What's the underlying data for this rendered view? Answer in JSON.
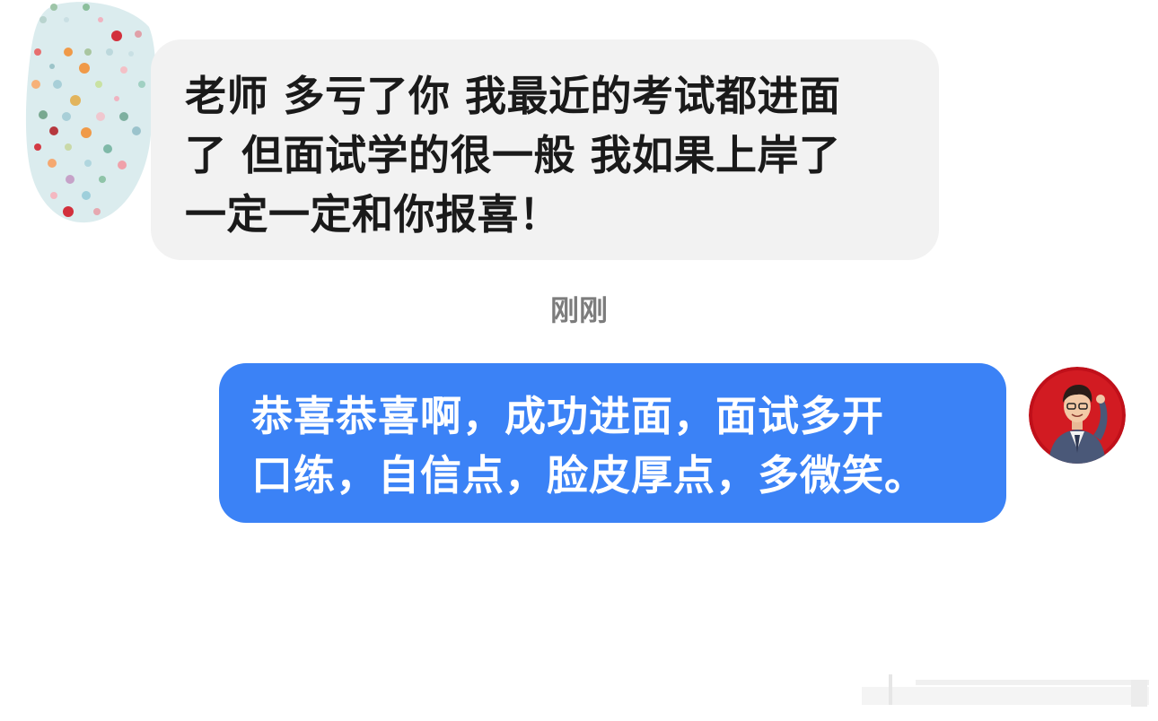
{
  "messages": {
    "incoming": {
      "text": "老师 多亏了你 我最近的考试都进面\n了 但面试学的很一般 我如果上岸了\n一定一定和你报喜！"
    },
    "timestamp": "刚刚",
    "outgoing": {
      "text": "恭喜恭喜啊，成功进面，面试多开\n口练，自信点，脸皮厚点，多微笑。"
    }
  },
  "colors": {
    "incoming_bubble": "#f2f2f2",
    "outgoing_bubble": "#3b82f6",
    "timestamp": "#7c7c7c",
    "avatar_red": "#c0101a"
  },
  "icons": {
    "incoming_avatar": "polka-dot-avatar",
    "outgoing_avatar": "person-photo-avatar"
  }
}
